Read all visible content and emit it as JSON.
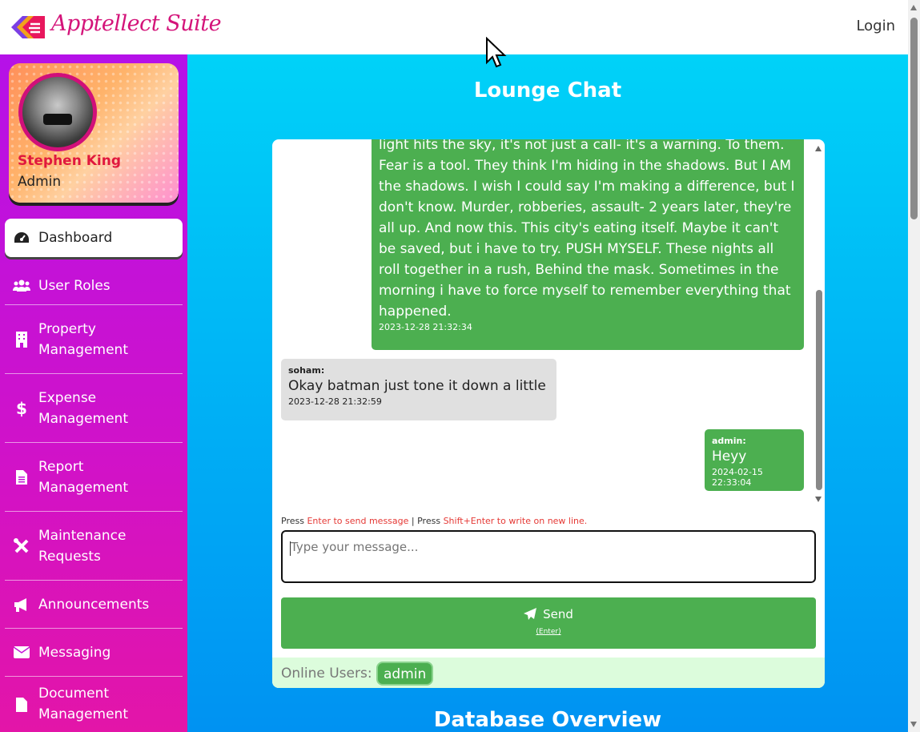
{
  "app": {
    "brand": "Apptellect Suite",
    "login_label": "Login"
  },
  "profile": {
    "name": "Stephen King",
    "role": "Admin"
  },
  "nav": [
    {
      "label": "Dashboard",
      "icon": "dashboard-icon"
    },
    {
      "label": "User Roles",
      "icon": "users-icon"
    },
    {
      "label": "Property Management",
      "icon": "building-icon"
    },
    {
      "label": "Expense Management",
      "icon": "dollar-icon"
    },
    {
      "label": "Report Management",
      "icon": "file-icon"
    },
    {
      "label": "Maintenance Requests",
      "icon": "tools-icon"
    },
    {
      "label": "Announcements",
      "icon": "megaphone-icon"
    },
    {
      "label": "Messaging",
      "icon": "envelope-icon"
    },
    {
      "label": "Document Management",
      "icon": "document-icon"
    }
  ],
  "chat": {
    "title": "Lounge Chat",
    "messages": [
      {
        "sender": "",
        "text": "light hits the sky, it's not just a call- it's a warning. To them. Fear is a tool. They think I'm hiding in the shadows. But I AM the shadows. I wish I could say I'm making a difference, but I don't know. Murder, robberies, assault- 2 years later, they're all up. And now this. This city's eating itself. Maybe it can't be saved, but i have to try. PUSH MYSELF. These nights all roll together in a rush, Behind the mask. Sometimes in the morning i have to force myself to remember everything that happened.",
        "time": "2023-12-28 21:32:34"
      },
      {
        "sender": "soham:",
        "text": "Okay batman just tone it down a little",
        "time": "2023-12-28 21:32:59"
      },
      {
        "sender": "admin:",
        "text": "Heyy",
        "time": "2024-02-15 22:33:04"
      }
    ],
    "hint": {
      "press1": "Press ",
      "enter": "Enter to send message",
      "sep": " | Press ",
      "shift": "Shift+Enter to write on new line."
    },
    "input_placeholder": "Type your message...",
    "send_label": "Send",
    "send_sub": "(Enter)",
    "online_label": "Online Users:",
    "online_users": [
      "admin"
    ]
  },
  "section2_title": "Database Overview",
  "colors": {
    "accent_green": "#4caf50",
    "brand_pink": "#d4147a",
    "sidebar": "#c512d8",
    "main_bg": "#00c4f8"
  }
}
